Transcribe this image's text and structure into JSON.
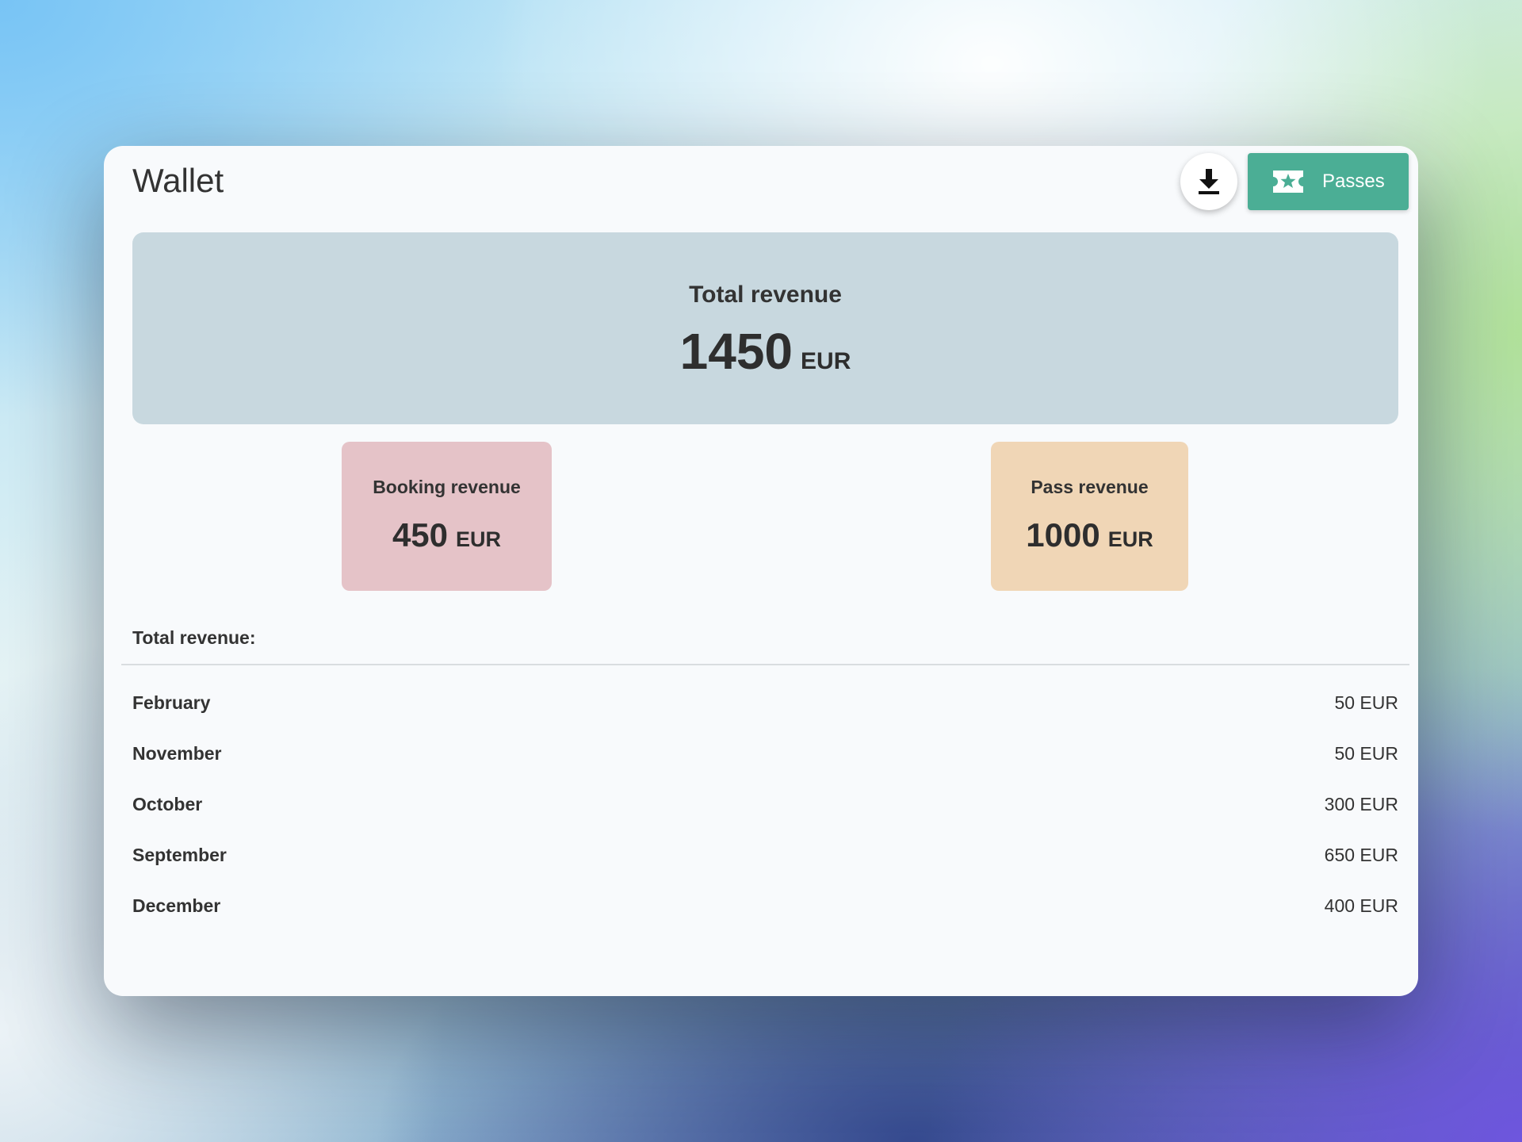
{
  "header": {
    "title": "Wallet",
    "download_icon": "download-icon",
    "passes_label": "Passes",
    "passes_icon": "ticket-star-icon"
  },
  "summary": {
    "total": {
      "label": "Total revenue",
      "value": "1450",
      "currency": "EUR"
    },
    "booking": {
      "label": "Booking revenue",
      "value": "450",
      "currency": "EUR"
    },
    "pass": {
      "label": "Pass revenue",
      "value": "1000",
      "currency": "EUR"
    }
  },
  "breakdown": {
    "header": "Total revenue:",
    "rows": [
      {
        "month": "February",
        "amount": "50 EUR"
      },
      {
        "month": "November",
        "amount": "50 EUR"
      },
      {
        "month": "October",
        "amount": "300 EUR"
      },
      {
        "month": "September",
        "amount": "650 EUR"
      },
      {
        "month": "December",
        "amount": "400 EUR"
      }
    ]
  },
  "colors": {
    "accent": "#4bae95",
    "total_box": "#c8d8df",
    "booking_box": "#e5c3c8",
    "pass_box": "#f0d6b6"
  }
}
